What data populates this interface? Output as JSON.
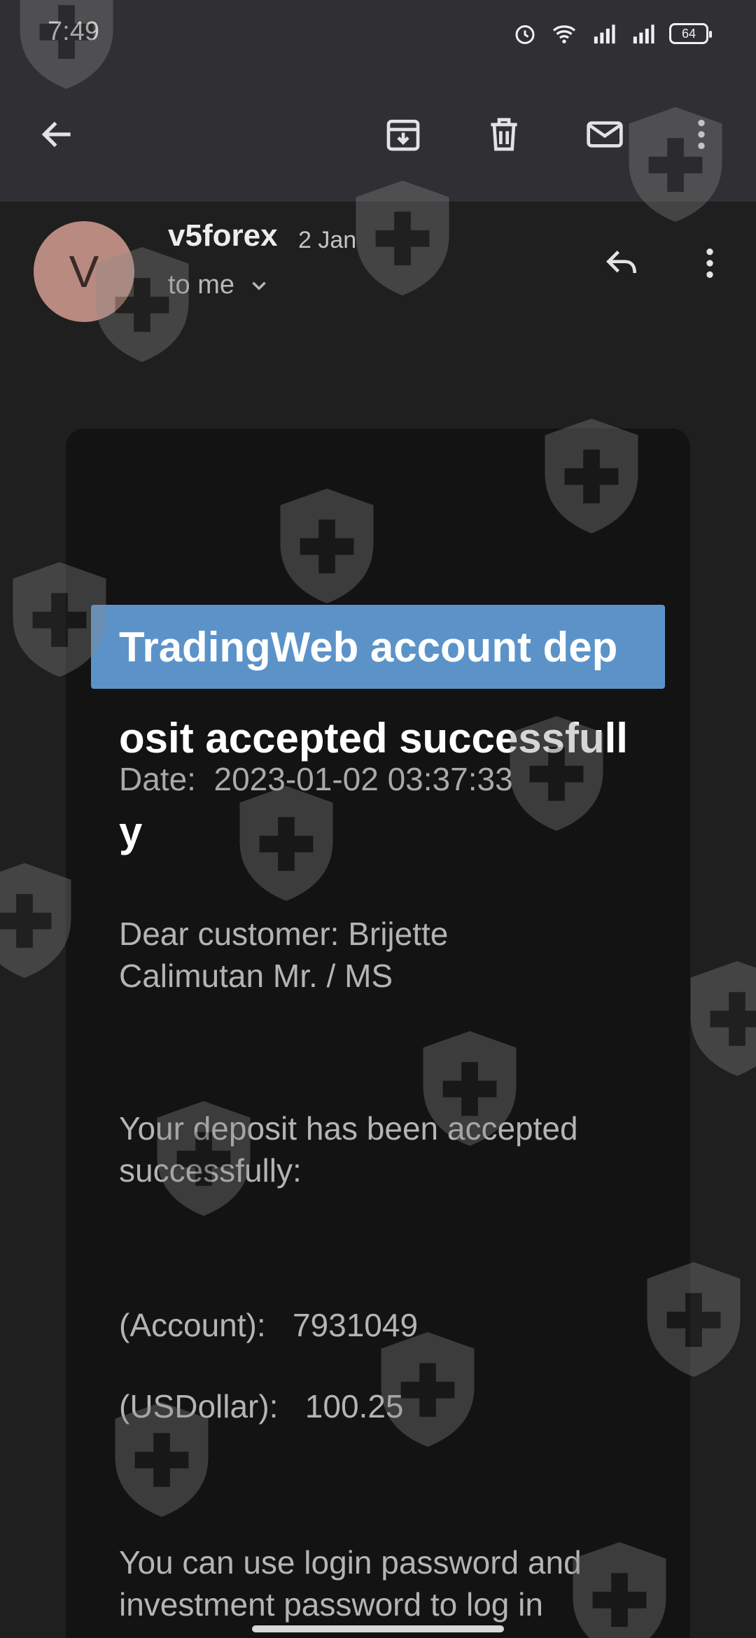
{
  "status_bar": {
    "time": "7:49",
    "battery": "64",
    "icons": [
      "alarm-icon",
      "wifi-icon",
      "signal-icon",
      "signal-icon",
      "battery-icon"
    ]
  },
  "app_bar": {
    "icons": [
      "back-arrow-icon",
      "archive-icon",
      "delete-icon",
      "mail-icon",
      "more-vert-icon"
    ]
  },
  "email": {
    "avatar_letter": "V",
    "sender": "v5forex",
    "date": "2 Jan",
    "recipient": "to me"
  },
  "message": {
    "banner_line1": "TradingWeb account dep",
    "banner_line2": "osit accepted successfull",
    "banner_line3": "y",
    "date_line": "Date:  2023-01-02 03:37:33",
    "greeting_line1": "Dear customer: Brijette",
    "greeting_line2": "Calimutan Mr. / MS",
    "body_line1": "Your deposit has been accepted",
    "body_line2": "successfully:",
    "account": "(Account):   7931049",
    "amount": "(USDollar):   100.25",
    "footer_line1": "You can use login password and",
    "footer_line2": "investment password to log in"
  },
  "colors": {
    "banner": "#5b93c9",
    "avatar": "#b98a80",
    "app_bar": "#303034",
    "background": "#1f1f1f"
  }
}
